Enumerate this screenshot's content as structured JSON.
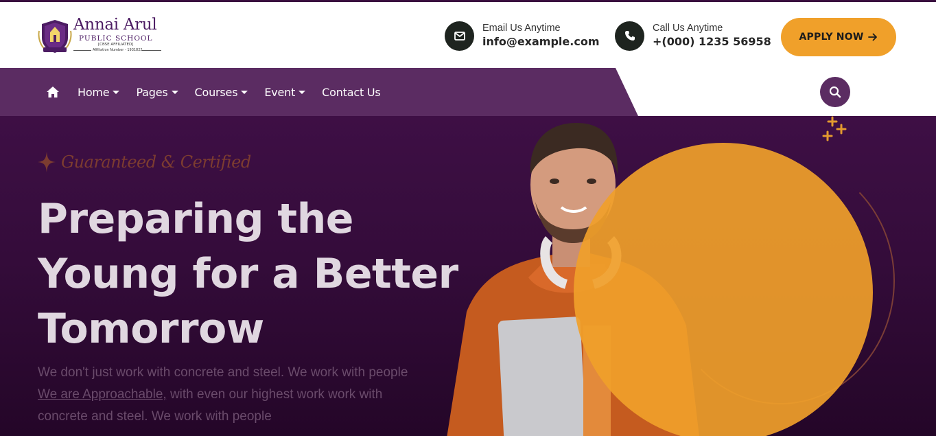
{
  "logo": {
    "name": "Annai Arul",
    "subtitle": "PUBLIC SCHOOL",
    "affiliation_label": "[CBSE AFFILIATED]",
    "affiliation_number": "Affiliation Number - 1931822",
    "crest_icon": "school-crest-icon"
  },
  "contact": {
    "email": {
      "label": "Email Us Anytime",
      "value": "info@example.com",
      "icon": "envelope-icon"
    },
    "phone": {
      "label": "Call Us Anytime",
      "value": "+(000) 1235 56958",
      "icon": "phone-icon"
    }
  },
  "apply_button": {
    "label": "APPLY NOW",
    "icon": "arrow-right-icon"
  },
  "nav": {
    "home_icon": "home-icon",
    "items": [
      {
        "label": "Home",
        "has_dropdown": true
      },
      {
        "label": "Pages",
        "has_dropdown": true
      },
      {
        "label": "Courses",
        "has_dropdown": true
      },
      {
        "label": "Event",
        "has_dropdown": true
      },
      {
        "label": "Contact Us",
        "has_dropdown": false
      }
    ],
    "search_icon": "search-icon"
  },
  "hero": {
    "tagline": "Guaranteed & Certified",
    "headline": [
      "Preparing the",
      "Young for a Better",
      "Tomorrow"
    ],
    "para_line1": "We don't just work with concrete and steel. We work with people",
    "para_link": "We are Approachable,",
    "para_line2_rest": " with even our highest work work with",
    "para_line3": "concrete and steel. We work with people"
  },
  "colors": {
    "brand_purple": "#5b2c62",
    "hero_bg": "#3e0f45",
    "accent_orange": "#f0a02a",
    "dark_icon_bg": "#1e241f"
  }
}
